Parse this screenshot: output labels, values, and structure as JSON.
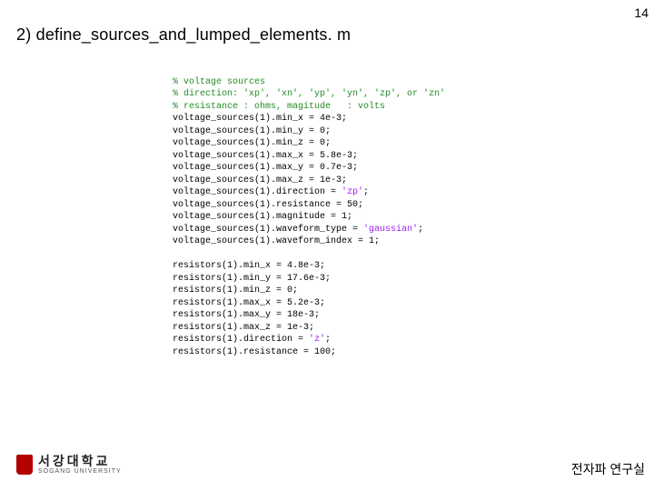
{
  "page_number": "14",
  "title": "2) define_sources_and_lumped_elements. m",
  "code": {
    "c1": "% voltage sources",
    "c2": "% direction: 'xp', 'xn', 'yp', 'yn', 'zp', or 'zn'",
    "c3": "% resistance : ohms, magitude   : volts",
    "l01": "voltage_sources(1).min_x = 4e-3;",
    "l02": "voltage_sources(1).min_y = 0;",
    "l03": "voltage_sources(1).min_z = 0;",
    "l04": "voltage_sources(1).max_x = 5.8e-3;",
    "l05": "voltage_sources(1).max_y = 0.7e-3;",
    "l06": "voltage_sources(1).max_z = 1e-3;",
    "l07a": "voltage_sources(1).direction = ",
    "l07s": "'zp'",
    "l07b": ";",
    "l08": "voltage_sources(1).resistance = 50;",
    "l09": "voltage_sources(1).magnitude = 1;",
    "l10a": "voltage_sources(1).waveform_type = ",
    "l10s": "'gaussian'",
    "l10b": ";",
    "l11": "voltage_sources(1).waveform_index = 1;",
    "r01": "resistors(1).min_x = 4.8e-3;",
    "r02": "resistors(1).min_y = 17.6e-3;",
    "r03": "resistors(1).min_z = 0;",
    "r04": "resistors(1).max_x = 5.2e-3;",
    "r05": "resistors(1).max_y = 18e-3;",
    "r06": "resistors(1).max_z = 1e-3;",
    "r07a": "resistors(1).direction = ",
    "r07s": "'z'",
    "r07b": ";",
    "r08": "resistors(1).resistance = 100;"
  },
  "logo": {
    "korean": "서강대학교",
    "english": "SOGANG UNIVERSITY"
  },
  "lab": "전자파 연구실"
}
